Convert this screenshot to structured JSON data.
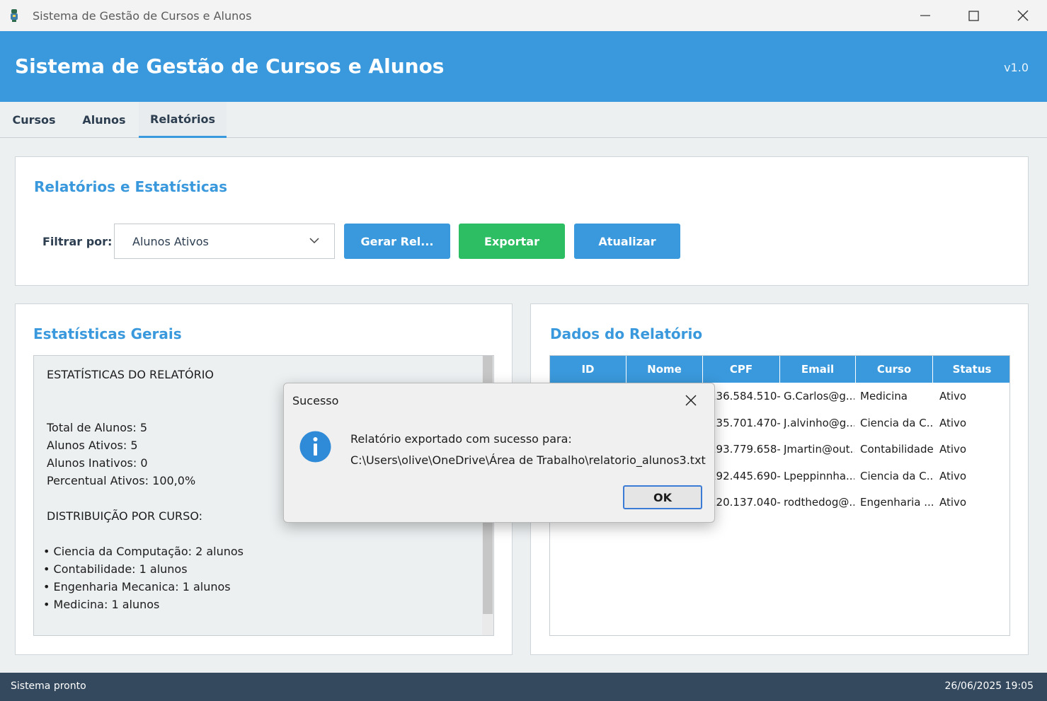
{
  "window": {
    "title": "Sistema de Gestão de Cursos e Alunos",
    "controls": [
      "minimize-icon",
      "maximize-icon",
      "close-icon"
    ]
  },
  "header": {
    "title": "Sistema de Gestão de Cursos e Alunos",
    "version": "v1.0"
  },
  "tabs": [
    {
      "label": "Cursos",
      "active": false
    },
    {
      "label": "Alunos",
      "active": false
    },
    {
      "label": "Relatórios",
      "active": true
    }
  ],
  "reports_panel": {
    "title": "Relatórios e Estatísticas",
    "filter_label": "Filtrar por:",
    "filter_value": "Alunos Ativos",
    "buttons": {
      "generate": "Gerar Rel...",
      "export": "Exportar",
      "refresh": "Atualizar"
    }
  },
  "stats_panel": {
    "title": "Estatísticas Gerais",
    "lines": [
      "ESTATÍSTICAS DO RELATÓRIO",
      "Total de Alunos: 5",
      "Alunos Ativos: 5",
      "Alunos Inativos: 0",
      "Percentual Ativos: 100,0%",
      "DISTRIBUIÇÃO POR CURSO:",
      "• Ciencia da Computação: 2 alunos",
      "• Contabilidade: 1 alunos",
      "• Engenharia Mecanica: 1 alunos",
      "• Medicina: 1 alunos"
    ]
  },
  "data_panel": {
    "title": "Dados do Relatório",
    "columns": [
      "ID",
      "Nome",
      "CPF",
      "Email",
      "Curso",
      "Status"
    ],
    "rows": [
      {
        "cpf": "136.584.510-...",
        "email": "G.Carlos@g...",
        "curso": "Medicina",
        "status": "Ativo"
      },
      {
        "cpf": "135.701.470-...",
        "email": "J.alvinho@g...",
        "curso": "Ciencia da C...",
        "status": "Ativo"
      },
      {
        "cpf": "193.779.658-...",
        "email": "Jmartin@out...",
        "curso": "Contabilidade",
        "status": "Ativo"
      },
      {
        "cpf": "192.445.690-...",
        "email": "Lpeppinnha...",
        "curso": "Ciencia da C...",
        "status": "Ativo"
      },
      {
        "cpf": "120.137.040-...",
        "email": "rodthedog@...",
        "curso": "Engenharia ...",
        "status": "Ativo"
      }
    ]
  },
  "dialog": {
    "title": "Sucesso",
    "icon": "info-icon",
    "message_line1": "Relatório exportado com sucesso para:",
    "message_line2": "C:\\Users\\olive\\OneDrive\\Área de Trabalho\\relatorio_alunos3.txt",
    "ok_label": "OK"
  },
  "statusbar": {
    "status": "Sistema pronto",
    "datetime": "26/06/2025 19:05"
  },
  "colors": {
    "primary": "#3a99dc",
    "success": "#2dbd63",
    "statusbar": "#34495e",
    "background": "#ecf0f1"
  }
}
